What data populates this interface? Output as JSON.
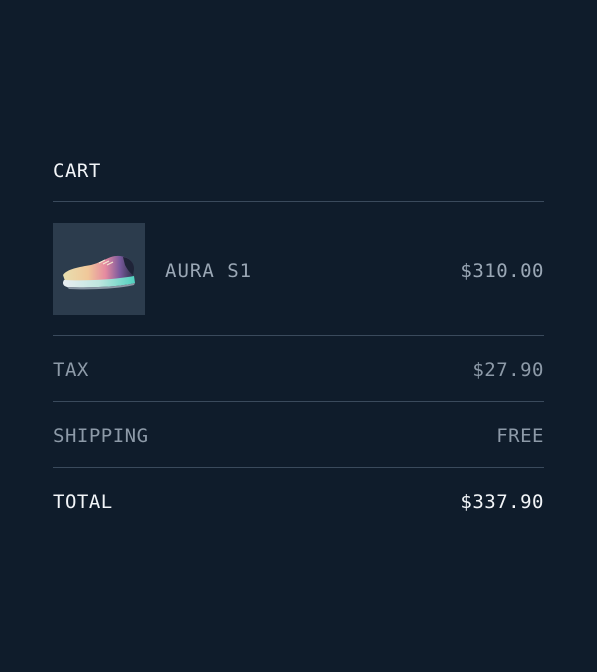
{
  "cart": {
    "title": "CART",
    "items": [
      {
        "name": "AURA S1",
        "price": "$310.00",
        "thumbnail": "sneaker-image"
      }
    ],
    "summary": {
      "tax_label": "TAX",
      "tax_value": "$27.90",
      "shipping_label": "SHIPPING",
      "shipping_value": "FREE",
      "total_label": "TOTAL",
      "total_value": "$337.90"
    }
  },
  "colors": {
    "background": "#0f1c2b",
    "divider": "#3a4a5c",
    "text_primary": "#f2f5f8",
    "text_muted": "#8d9aa8",
    "thumbnail_bg": "#2c3c4d"
  }
}
